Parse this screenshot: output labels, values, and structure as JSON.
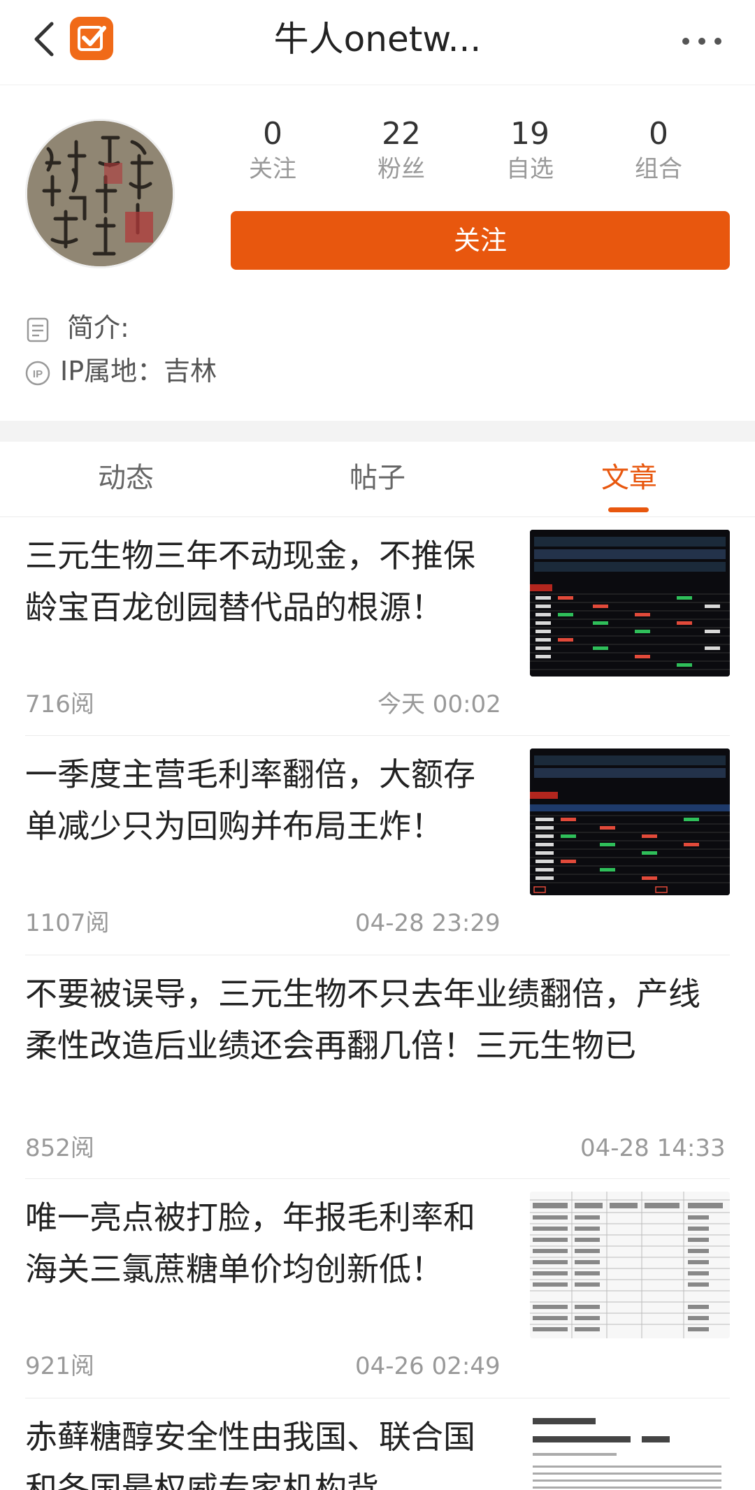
{
  "header": {
    "title": "牛人onetw...",
    "back_icon": "chevron-left-icon",
    "logo_icon": "checkmark-logo-icon",
    "more_icon": "more-horizontal-icon",
    "brand_color": "#e8570e"
  },
  "profile": {
    "stats": [
      {
        "value": "0",
        "label": "关注"
      },
      {
        "value": "22",
        "label": "粉丝"
      },
      {
        "value": "19",
        "label": "自选"
      },
      {
        "value": "0",
        "label": "组合"
      }
    ],
    "follow_label": "关注",
    "bio_label": "简介:",
    "ip_label": "IP属地：吉林"
  },
  "tabs": [
    {
      "label": "动态",
      "active": false
    },
    {
      "label": "帖子",
      "active": false
    },
    {
      "label": "文章",
      "active": true
    }
  ],
  "articles": [
    {
      "title": "三元生物三年不动现金，不推保龄宝百龙创园替代品的根源！",
      "reads": "716阅",
      "time": "今天 00:02",
      "thumb": "dark-stock-table"
    },
    {
      "title": "一季度主营毛利率翻倍，大额存单减少只为回购并布局王炸！",
      "reads": "1107阅",
      "time": "04-28 23:29",
      "thumb": "dark-stock-table"
    },
    {
      "title": "不要被误导，三元生物不只去年业绩翻倍，产线柔性改造后业绩还会再翻几倍！三元生物已",
      "reads": "852阅",
      "time": "04-28 14:33",
      "thumb": ""
    },
    {
      "title": "唯一亮点被打脸，年报毛利率和海关三氯蔗糖单价均创新低！",
      "reads": "921阅",
      "time": "04-26 02:49",
      "thumb": "light-customs-table"
    },
    {
      "title": "赤藓糖醇安全性由我国、联合国和各国最权威专家机构背",
      "reads": "",
      "time": "",
      "thumb": "document-page"
    }
  ]
}
